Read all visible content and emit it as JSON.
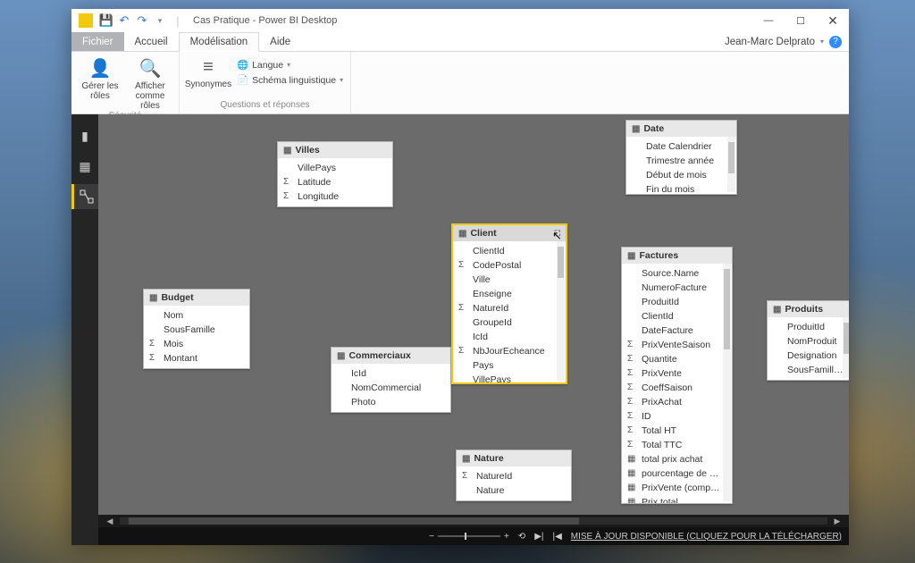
{
  "window": {
    "title": "Cas Pratique - Power BI Desktop",
    "user": "Jean-Marc Delprato"
  },
  "menu": {
    "file": "Fichier",
    "home": "Accueil",
    "modeling": "Modélisation",
    "help": "Aide"
  },
  "ribbon": {
    "manage_roles": "Gérer les\nrôles",
    "view_as": "Afficher\ncomme rôles",
    "security_title": "Sécurité",
    "synonyms": "Synonymes",
    "language": "Langue",
    "schema": "Schéma linguistique",
    "qa_title": "Questions et réponses"
  },
  "statusbar": {
    "update": "MISE À JOUR DISPONIBLE (CLIQUEZ POUR LA TÉLÉCHARGER)"
  },
  "tables": {
    "villes": {
      "name": "Villes",
      "fields": [
        {
          "name": "VillePays",
          "icon": ""
        },
        {
          "name": "Latitude",
          "icon": "Σ"
        },
        {
          "name": "Longitude",
          "icon": "Σ"
        }
      ]
    },
    "budget": {
      "name": "Budget",
      "fields": [
        {
          "name": "Nom",
          "icon": ""
        },
        {
          "name": "SousFamille",
          "icon": ""
        },
        {
          "name": "Mois",
          "icon": "Σ"
        },
        {
          "name": "Montant",
          "icon": "Σ"
        }
      ]
    },
    "commerciaux": {
      "name": "Commerciaux",
      "fields": [
        {
          "name": "IcId",
          "icon": ""
        },
        {
          "name": "NomCommercial",
          "icon": ""
        },
        {
          "name": "Photo",
          "icon": ""
        }
      ]
    },
    "client": {
      "name": "Client",
      "fields": [
        {
          "name": "ClientId",
          "icon": ""
        },
        {
          "name": "CodePostal",
          "icon": "Σ"
        },
        {
          "name": "Ville",
          "icon": ""
        },
        {
          "name": "Enseigne",
          "icon": ""
        },
        {
          "name": "NatureId",
          "icon": "Σ"
        },
        {
          "name": "GroupeId",
          "icon": ""
        },
        {
          "name": "IcId",
          "icon": ""
        },
        {
          "name": "NbJourEcheance",
          "icon": "Σ"
        },
        {
          "name": "Pays",
          "icon": ""
        },
        {
          "name": "VillePays",
          "icon": ""
        }
      ]
    },
    "nature": {
      "name": "Nature",
      "fields": [
        {
          "name": "NatureId",
          "icon": "Σ"
        },
        {
          "name": "Nature",
          "icon": ""
        }
      ]
    },
    "date": {
      "name": "Date",
      "fields": [
        {
          "name": "Date Calendrier",
          "icon": ""
        },
        {
          "name": "Trimestre année",
          "icon": ""
        },
        {
          "name": "Début de mois",
          "icon": ""
        },
        {
          "name": "Fin du mois",
          "icon": ""
        }
      ]
    },
    "factures": {
      "name": "Factures",
      "fields": [
        {
          "name": "Source.Name",
          "icon": ""
        },
        {
          "name": "NumeroFacture",
          "icon": ""
        },
        {
          "name": "ProduitId",
          "icon": ""
        },
        {
          "name": "ClientId",
          "icon": ""
        },
        {
          "name": "DateFacture",
          "icon": ""
        },
        {
          "name": "PrixVenteSaison",
          "icon": "Σ"
        },
        {
          "name": "Quantite",
          "icon": "Σ"
        },
        {
          "name": "PrixVente",
          "icon": "Σ"
        },
        {
          "name": "CoeffSaison",
          "icon": "Σ"
        },
        {
          "name": "PrixAchat",
          "icon": "Σ"
        },
        {
          "name": "ID",
          "icon": "Σ"
        },
        {
          "name": "Total HT",
          "icon": "Σ"
        },
        {
          "name": "Total TTC",
          "icon": "Σ"
        },
        {
          "name": "total prix achat",
          "icon": "▦"
        },
        {
          "name": "pourcentage de mar…",
          "icon": "▦"
        },
        {
          "name": "PrixVente (compartim…",
          "icon": "▦"
        },
        {
          "name": "Prix total",
          "icon": "▦"
        }
      ]
    },
    "produits": {
      "name": "Produits",
      "fields": [
        {
          "name": "ProduitId",
          "icon": ""
        },
        {
          "name": "NomProduit",
          "icon": ""
        },
        {
          "name": "Designation",
          "icon": ""
        },
        {
          "name": "SousFamilleId",
          "icon": ""
        }
      ]
    }
  }
}
